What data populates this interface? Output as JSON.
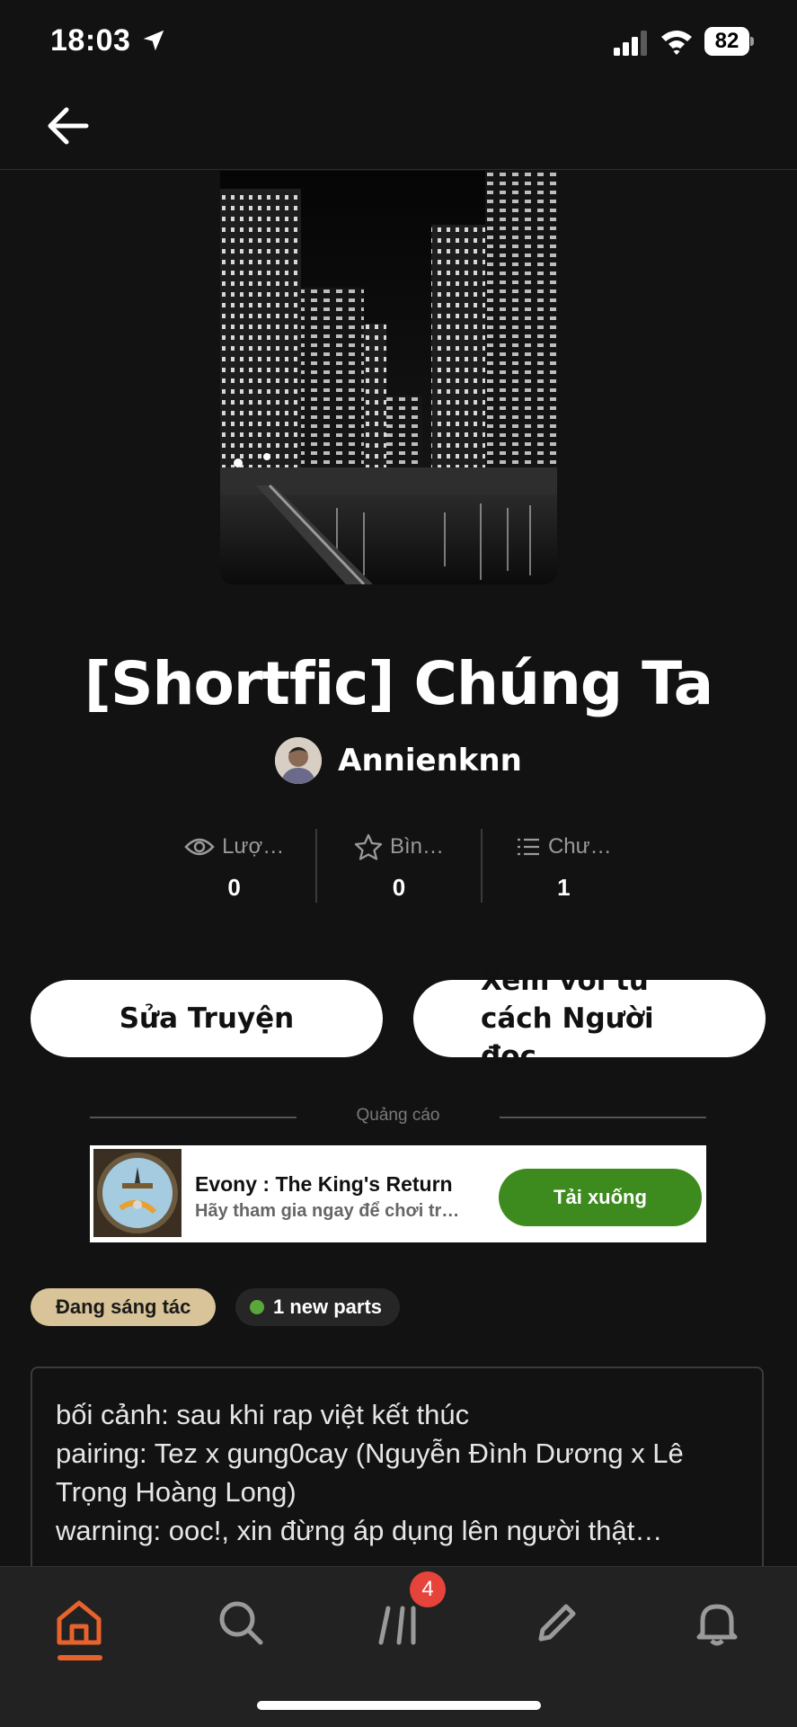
{
  "status_bar": {
    "time": "18:03",
    "battery": "82"
  },
  "story": {
    "title": "[Shortfic] Chúng Ta",
    "author": "Annienknn",
    "stats": [
      {
        "label": "Lượ…",
        "value": "0",
        "icon": "eye-icon"
      },
      {
        "label": "Bìn…",
        "value": "0",
        "icon": "star-icon"
      },
      {
        "label": "Chư…",
        "value": "1",
        "icon": "list-icon"
      }
    ]
  },
  "actions": {
    "edit_label": "Sửa Truyện",
    "view_label": "Xem với tư cách Người đọc"
  },
  "ad": {
    "label": "Quảng cáo",
    "title": "Evony : The King's Return",
    "description": "Hãy tham gia ngay để chơi tr…",
    "button": "Tải xuống"
  },
  "tags": {
    "status": "Đang sáng tác",
    "new_parts": "1 new parts"
  },
  "description": {
    "lines": [
      "bối cảnh: sau khi rap việt kết thúc",
      "pairing: Tez x gung0cay (Nguyễn Đình Dương x Lê Trọng Hoàng Long)",
      "warning: ooc!, xin đừng áp dụng lên người thật…"
    ]
  },
  "tabbar": {
    "items": [
      "home-icon",
      "search-icon",
      "library-icon",
      "write-icon",
      "bell-icon"
    ],
    "library_badge": "4",
    "active": "home"
  },
  "colors": {
    "accent": "#e8632c",
    "status_tag": "#d9c499",
    "ad_button": "#3d8a1e",
    "badge": "#e6443a"
  }
}
